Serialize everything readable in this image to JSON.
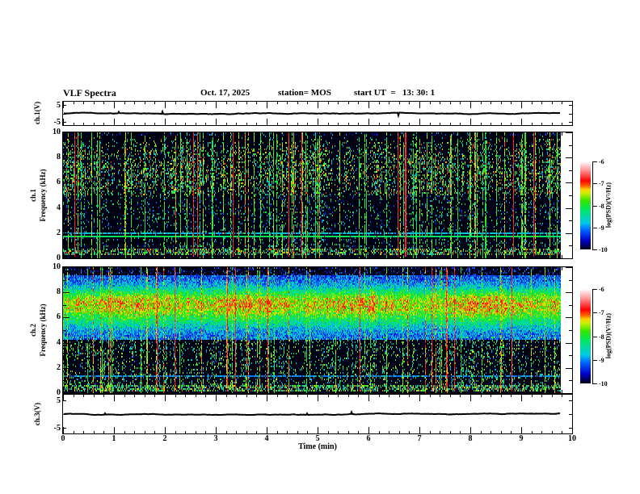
{
  "header": {
    "title": "VLF Spectra",
    "date": "Oct. 17, 2025",
    "station": "station= MOS",
    "start_ut": "start UT  =   13: 30: 1"
  },
  "x_axis": {
    "label": "Time (min)",
    "tick_labels": [
      "0",
      "1",
      "2",
      "3",
      "4",
      "5",
      "6",
      "7",
      "8",
      "9",
      "10"
    ],
    "min": 0,
    "max": 10,
    "minor_step": 0.2
  },
  "frequency_axis": {
    "tick_labels": [
      "10",
      "8",
      "6",
      "4",
      "2",
      "0"
    ],
    "min": 0,
    "max": 10
  },
  "voltage_axis": {
    "tick_labels": [
      "5",
      "-5"
    ],
    "min": -5,
    "max": 5
  },
  "panels": {
    "ch1_voltage": {
      "ylabel": "ch.1(V)"
    },
    "ch1_spectrogram": {
      "channel_label": "ch.1",
      "axis_label": "Frequency (kHz)"
    },
    "ch2_spectrogram": {
      "channel_label": "ch.2",
      "axis_label": "Frequency (kHz)"
    },
    "ch3_voltage": {
      "ylabel": "ch.3(V)"
    }
  },
  "colorbar": {
    "unit_label": "log(PSD)(V²/Hz)",
    "tick_labels": [
      "-6",
      "-7",
      "-8",
      "-9",
      "-10"
    ],
    "min": -10,
    "max": -6
  },
  "colormap": {
    "min": -10,
    "max": -6,
    "stops": [
      [
        0.0,
        "#000014"
      ],
      [
        0.1,
        "#0000c8"
      ],
      [
        0.22,
        "#0064ff"
      ],
      [
        0.3,
        "#00c8e6"
      ],
      [
        0.45,
        "#00e664"
      ],
      [
        0.55,
        "#32e600"
      ],
      [
        0.64,
        "#c8f000"
      ],
      [
        0.68,
        "#ffd200"
      ],
      [
        0.72,
        "#ff6400"
      ],
      [
        0.78,
        "#ff0000"
      ],
      [
        0.9,
        "#ff9696"
      ],
      [
        1.0,
        "#ffffff"
      ]
    ]
  },
  "chart_data": [
    {
      "id": "ch1_voltage",
      "type": "line",
      "ylabel": "ch.1(V)",
      "ylim": [
        -5,
        5
      ],
      "xlim_min": [
        0,
        10
      ],
      "value": 0,
      "end_min": 9.78,
      "noise_v": 0.1,
      "seed": 7
    },
    {
      "id": "ch1_spectrogram",
      "type": "heatmap",
      "ylabel": "ch.1 Frequency (kHz)",
      "ylim": [
        0,
        10
      ],
      "xlim_min": [
        0,
        10
      ],
      "end_min": 9.78,
      "color_scale": {
        "label": "log(PSD)(V²/Hz)",
        "min": -10,
        "max": -6
      },
      "seed": 11,
      "gap_prob": 0.1,
      "bands": [
        {
          "type": "patchy",
          "fmin": 5.0,
          "fmax": 9.7,
          "intensity": -8.0,
          "variance": 1.0,
          "density": 0.55
        },
        {
          "type": "streaks",
          "fmin": 0.8,
          "fmax": 5.0,
          "intensity": -8.6,
          "variance": 0.9,
          "density": 0.22
        },
        {
          "type": "speckle",
          "fmin": 9.7,
          "fmax": 10.0,
          "intensity": -9.2,
          "variance": 0.5,
          "density": 0.18
        },
        {
          "type": "line",
          "fmin": 1.72,
          "fmax": 1.84,
          "intensity": -8.2,
          "variance": 0.4,
          "density": 0.97
        },
        {
          "type": "line",
          "fmin": 1.95,
          "fmax": 2.03,
          "intensity": -8.8,
          "variance": 0.4,
          "density": 0.85
        },
        {
          "type": "busy",
          "fmin": 0.25,
          "fmax": 0.8,
          "intensity": -8.0,
          "variance": 1.0,
          "density": 0.6
        }
      ],
      "sferics": {
        "prob": 0.1,
        "intensity": -7.8,
        "red_prob": 0.016,
        "red_intensity": -6.8
      }
    },
    {
      "id": "ch2_spectrogram",
      "type": "heatmap",
      "ylabel": "ch.2 Frequency (kHz)",
      "ylim": [
        0,
        10
      ],
      "xlim_min": [
        0,
        10
      ],
      "end_min": 9.78,
      "color_scale": {
        "label": "log(PSD)(V²/Hz)",
        "min": -10,
        "max": -6
      },
      "seed": 22,
      "gap_prob": 0.06,
      "bands": [
        {
          "type": "band",
          "fmin": 4.2,
          "fmax": 9.4,
          "peak": 7.1,
          "intensity": -6.95,
          "edge": -9.3,
          "variance": 0.55,
          "density": 1
        },
        {
          "type": "streaks",
          "fmin": 0.5,
          "fmax": 4.5,
          "intensity": -8.2,
          "variance": 0.9,
          "density": 0.34
        },
        {
          "type": "speckle",
          "fmin": 9.4,
          "fmax": 10.0,
          "intensity": -9.3,
          "variance": 0.4,
          "density": 0.25
        },
        {
          "type": "line",
          "fmin": 0.98,
          "fmax": 1.08,
          "intensity": -8.9,
          "variance": 0.3,
          "density": 0.9
        },
        {
          "type": "line",
          "fmin": 1.28,
          "fmax": 1.36,
          "intensity": -9.0,
          "variance": 0.3,
          "density": 0.8
        },
        {
          "type": "busy",
          "fmin": 0.15,
          "fmax": 0.6,
          "intensity": -8.1,
          "variance": 1.0,
          "density": 0.65
        }
      ],
      "sferics": {
        "prob": 0.07,
        "intensity": -7.6,
        "red_prob": 0.012,
        "red_intensity": -6.7
      }
    },
    {
      "id": "ch3_voltage",
      "type": "line",
      "ylabel": "ch.3(V)",
      "ylim": [
        -5,
        5
      ],
      "xlim_min": [
        0,
        10
      ],
      "value": 0,
      "end_min": 9.78,
      "noise_v": 0.1,
      "seed": 9
    }
  ]
}
